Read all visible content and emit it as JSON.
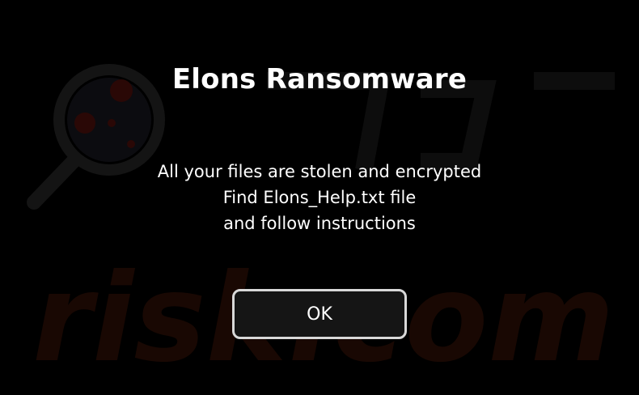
{
  "dialog": {
    "title": "Elons Ransomware",
    "message_lines": [
      "All your files are stolen and encrypted",
      "Find Elons_Help.txt file",
      "and follow instructions"
    ],
    "ok_label": "OK"
  },
  "watermark": {
    "text": "risk.com",
    "icon": "magnifier-icon"
  },
  "colors": {
    "background": "#000000",
    "text": "#ffffff",
    "button_border": "#d8d8d8",
    "button_fill": "#151515",
    "watermark_red": "#3a0c08",
    "watermark_gray": "#141414"
  }
}
